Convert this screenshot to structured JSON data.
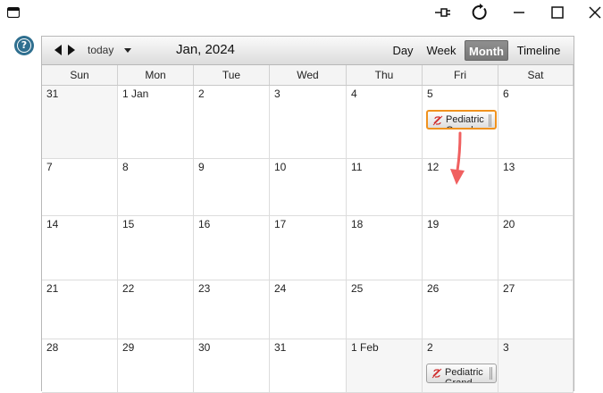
{
  "window": {
    "icons": [
      "window-icon",
      "pin-icon",
      "refresh-icon",
      "minimize-icon",
      "maximize-icon",
      "close-icon"
    ]
  },
  "help_icon": "question-circle-icon",
  "toolbar": {
    "today_label": "today",
    "month_title": "Jan, 2024",
    "views": [
      {
        "label": "Day",
        "active": false
      },
      {
        "label": "Week",
        "active": false
      },
      {
        "label": "Month",
        "active": true
      },
      {
        "label": "Timeline",
        "active": false
      }
    ]
  },
  "weekdays": [
    "Sun",
    "Mon",
    "Tue",
    "Wed",
    "Thu",
    "Fri",
    "Sat"
  ],
  "weeks": [
    [
      "31",
      "1 Jan",
      "2",
      "3",
      "4",
      "5",
      "6"
    ],
    [
      "7",
      "8",
      "9",
      "10",
      "11",
      "12",
      "13"
    ],
    [
      "14",
      "15",
      "16",
      "17",
      "18",
      "19",
      "20"
    ],
    [
      "21",
      "22",
      "23",
      "24",
      "25",
      "26",
      "27"
    ],
    [
      "28",
      "29",
      "30",
      "31",
      "1 Feb",
      "2",
      "3"
    ]
  ],
  "events": [
    {
      "title": "Pediatric Grand",
      "week": 0,
      "day": 5,
      "selected": true
    },
    {
      "title": "Pediatric Grand",
      "week": 4,
      "day": 5,
      "selected": false
    }
  ],
  "colors": {
    "selected_border": "#f0921e",
    "drag_arrow": "#f06060",
    "event_icon": "#d03030"
  }
}
